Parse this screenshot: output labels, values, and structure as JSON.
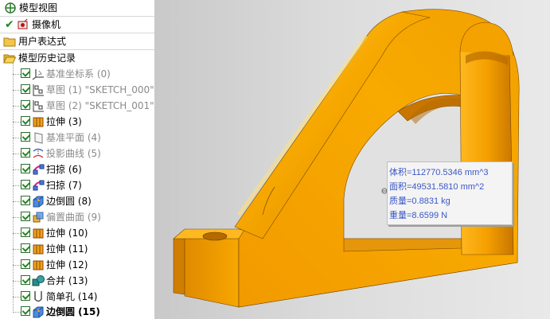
{
  "tree": {
    "items": [
      {
        "label": "模型视图",
        "icon": "model-view-icon",
        "checked": false,
        "style": "normal"
      },
      {
        "label": "摄像机",
        "icon": "camera-icon",
        "checked": true,
        "style": "normal"
      },
      {
        "label": "用户表达式",
        "icon": "folder-icon",
        "checked": false,
        "style": "normal"
      },
      {
        "label": "模型历史记录",
        "icon": "folder-open-icon",
        "checked": false,
        "style": "normal"
      },
      {
        "label": "基准坐标系 (0)",
        "icon": "datum-csys-icon",
        "checked": true,
        "style": "dim"
      },
      {
        "label": "草图 (1) \"SKETCH_000\"",
        "icon": "sketch-icon",
        "checked": true,
        "style": "dim"
      },
      {
        "label": "草图 (2) \"SKETCH_001\"",
        "icon": "sketch-icon",
        "checked": true,
        "style": "dim"
      },
      {
        "label": "拉伸 (3)",
        "icon": "extrude-icon",
        "checked": true,
        "style": "normal"
      },
      {
        "label": "基准平面 (4)",
        "icon": "datum-plane-icon",
        "checked": true,
        "style": "dim"
      },
      {
        "label": "投影曲线 (5)",
        "icon": "project-curve-icon",
        "checked": true,
        "style": "dim"
      },
      {
        "label": "扫掠 (6)",
        "icon": "sweep-icon",
        "checked": true,
        "style": "normal"
      },
      {
        "label": "扫掠 (7)",
        "icon": "sweep-icon",
        "checked": true,
        "style": "normal"
      },
      {
        "label": "边倒圆 (8)",
        "icon": "edge-blend-icon",
        "checked": true,
        "style": "normal"
      },
      {
        "label": "偏置曲面 (9)",
        "icon": "offset-surface-icon",
        "checked": true,
        "style": "dim"
      },
      {
        "label": "拉伸 (10)",
        "icon": "extrude-icon",
        "checked": true,
        "style": "normal"
      },
      {
        "label": "拉伸 (11)",
        "icon": "extrude-icon",
        "checked": true,
        "style": "normal"
      },
      {
        "label": "拉伸 (12)",
        "icon": "extrude-icon",
        "checked": true,
        "style": "normal"
      },
      {
        "label": "合并 (13)",
        "icon": "unite-icon",
        "checked": true,
        "style": "normal"
      },
      {
        "label": "简单孔 (14)",
        "icon": "hole-icon",
        "checked": true,
        "style": "normal"
      },
      {
        "label": "边倒圆 (15)",
        "icon": "edge-blend-icon",
        "checked": true,
        "style": "bold"
      }
    ]
  },
  "info_box": {
    "volume": "体积=112770.5346 mm^3",
    "area": "面积=49531.5810 mm^2",
    "mass": "质量=0.8831 kg",
    "weight": "重量=8.6599 N"
  },
  "colors": {
    "part_body": "#f5a100",
    "part_shadow": "#c97800",
    "part_highlight": "#ffc233",
    "info_text": "#3b57c6",
    "check_green": "#1e8a1e"
  }
}
